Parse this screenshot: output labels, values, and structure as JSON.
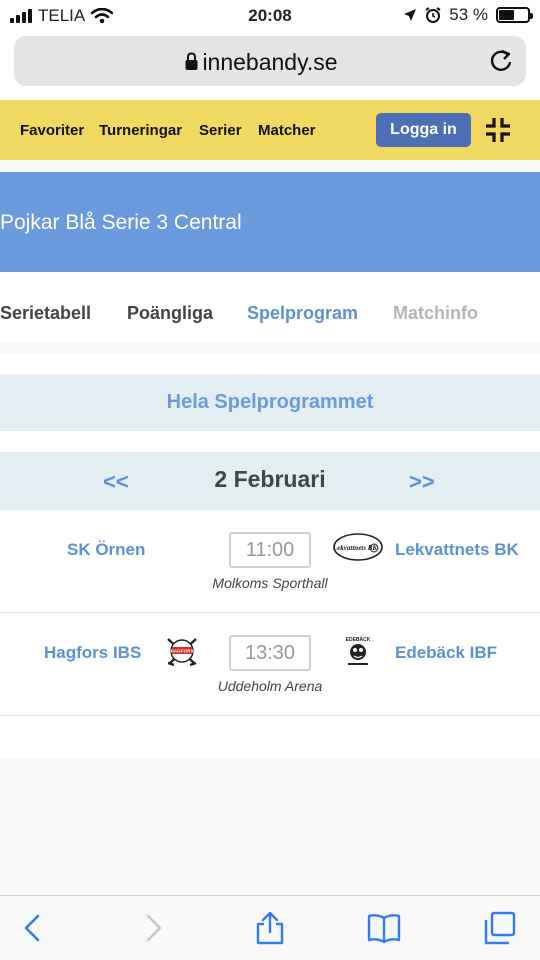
{
  "status_bar": {
    "carrier": "TELIA",
    "time": "20:08",
    "battery": "53 %",
    "battery_level": 0.53
  },
  "browser": {
    "url": "innebandy.se"
  },
  "topnav": {
    "items": [
      "Favoriter",
      "Turneringar",
      "Serier",
      "Matcher"
    ],
    "login_label": "Logga in"
  },
  "banner": {
    "title": "Pojkar Blå Serie 3 Central"
  },
  "tabs": [
    {
      "label": "Serietabell",
      "state": "normal"
    },
    {
      "label": "Poängliga",
      "state": "normal"
    },
    {
      "label": "Spelprogram",
      "state": "active"
    },
    {
      "label": "Matchinfo",
      "state": "disabled"
    }
  ],
  "schedule": {
    "full_program_label": "Hela Spelprogrammet",
    "prev_label": "<<",
    "next_label": ">>",
    "date": "2 Februari",
    "matches": [
      {
        "home": "SK Örnen",
        "away": "Lekvattnets BK",
        "time": "11:00",
        "venue": "Molkoms Sporthall",
        "home_logo": "",
        "away_logo": "Lekvattnets BK"
      },
      {
        "home": "Hagfors IBS",
        "away": "Edebäck IBF",
        "time": "13:30",
        "venue": "Uddeholm Arena",
        "home_logo": "HAGFORS",
        "away_logo": "EDEBÄCK"
      }
    ]
  },
  "colors": {
    "nav_yellow": "#f1d961",
    "banner_blue": "#6a9bdc",
    "link_blue": "#5b92d6",
    "login_blue": "#4a6fb5",
    "light_panel": "#e3eef2"
  }
}
